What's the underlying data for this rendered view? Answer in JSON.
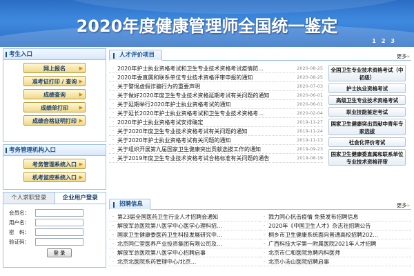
{
  "banner": {
    "title": "2020年度健康管理师全国统一鉴定",
    "pager": [
      "1",
      "2",
      "3"
    ]
  },
  "candidate": {
    "header": "考生入口",
    "buttons": [
      "网上报名",
      "准考证打印 / 查询",
      "成绩查询",
      "成绩单打印",
      "成绩合格证明打印"
    ]
  },
  "agency": {
    "header": "考务管理机构入口",
    "buttons": [
      "考务管理系统入口",
      "机考监控系统入口"
    ]
  },
  "login": {
    "tabs": [
      "个人求职登录",
      "企业用户登录"
    ],
    "fields": [
      {
        "label": "会员名：",
        "value": ""
      },
      {
        "label": "用户名：",
        "value": ""
      },
      {
        "label": "密　码：",
        "value": ""
      },
      {
        "label": "验证码：",
        "value": ""
      }
    ],
    "submit": "登 录"
  },
  "talent": {
    "title": "人才评价项目",
    "more": "更多",
    "more_icon": "»",
    "bullet": "·",
    "news": [
      {
        "title": "2020年护士执业资格考试和卫生专业技术资格考试疫情防...",
        "date": "2020-08-25"
      },
      {
        "title": "2020年委直属和联系单位专业技术资格评审申报的通知",
        "date": "2020-08-25"
      },
      {
        "title": "关于警惕虚假诈骗行为的重要声明",
        "date": "2020-07-03"
      },
      {
        "title": "关于做好2020年度卫生专业技术资格延期考试有关问题的通知",
        "date": "2020-06-01"
      },
      {
        "title": "关于延期举行2020年护士执业资格考试的通知",
        "date": "2020-06-01"
      },
      {
        "title": "关于延长2020年护士执业资格考试和卫生专业技术资格考...",
        "date": "2020-02-04"
      },
      {
        "title": "2020年护士执业资格考试安排确定",
        "date": "2019-11-27"
      },
      {
        "title": "关于2020年度卫生专业技术资格考试有关问题的通知",
        "date": "2019-11-24"
      },
      {
        "title": "关于2020年护士执业资格考试有关问题的通知",
        "date": "2019-11-13"
      },
      {
        "title": "关于组织开展第九届国家卫生健康突出贡献选拔工作的通知",
        "date": "2019-09-23"
      },
      {
        "title": "关于2019年度卫生专业技术资格考试合格标准有关问题的通告",
        "date": "2019-08-19"
      }
    ],
    "exam_buttons": [
      "全国卫生专业技术资格考试（中初级）",
      "护士执业资格考试",
      "高级卫生专业技术资格考试",
      "职业技能鉴定考试",
      "国家卫生健康突出贡献中青年专家选拔",
      "社会化评价考试",
      "国家卫生健康委直属和联系单位专业技术资格评审"
    ]
  },
  "recruit": {
    "title": "招聘信息",
    "more": "更多",
    "more_icon": "»",
    "bullet": "·",
    "left": [
      "第23届全国医药卫生行业人才招聘会通知",
      "解放军总医院第八医学中心医学心理科招...",
      "国家卫生健康委医药卫生科技发展研究中...",
      "北京同仁堂医养产业投资集团有限公司及...",
      "解放军总医院第八医学中心招聘启事",
      "北京北医院系药管理中心/北京..."
    ],
    "right": [
      "戮力同心抗击疫情 免费发布招聘信息",
      "2020年《中国卫生人才》杂志社招聘公告",
      "桐乡市卫生健康系统面向普通高校招聘202...",
      "广西科技大学第一附属医院2021年人才招聘",
      "北京市仁和医院急聘内科医师",
      "北京小汤山医院招聘启事"
    ]
  }
}
